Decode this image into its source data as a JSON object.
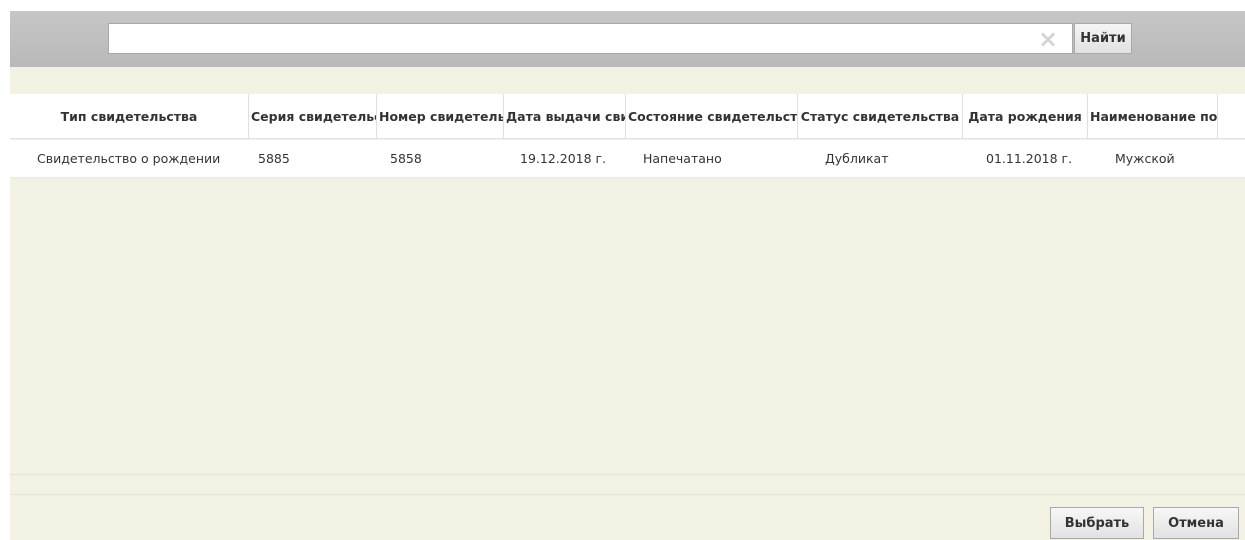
{
  "search": {
    "value": "",
    "placeholder": "",
    "clear_icon": "×",
    "find_label": "Найти"
  },
  "table": {
    "columns": [
      "Тип свидетельства",
      "Серия свидетельства",
      "Номер свидетельства",
      "Дата выдачи свидетельства",
      "Состояние свидетельства",
      "Статус свидетельства",
      "Дата рождения",
      "Наименование пола"
    ],
    "rows": [
      [
        "Свидетельство о рождении",
        "5885",
        "5858",
        "19.12.2018 г.",
        "Напечатано",
        "Дубликат",
        "01.11.2018 г.",
        "Мужской"
      ]
    ]
  },
  "footer": {
    "select_label": "Выбрать",
    "cancel_label": "Отмена"
  },
  "colors": {
    "toolbar": "#bdbdbd",
    "panel": "#f3f1e3"
  }
}
